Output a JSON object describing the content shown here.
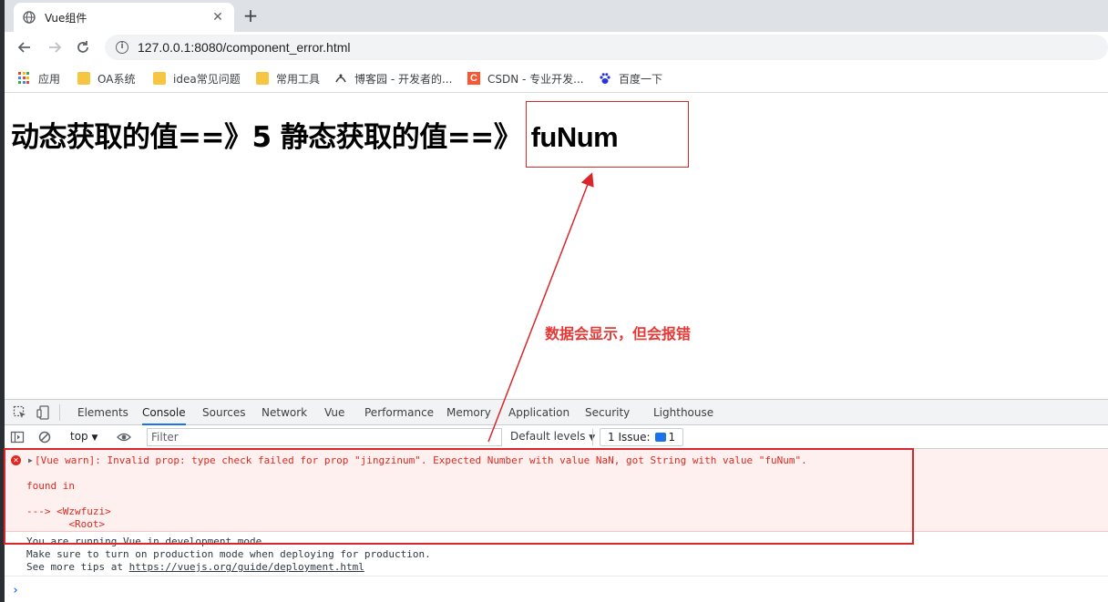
{
  "browser": {
    "tab_title": "Vue组件",
    "new_tab": "+",
    "close": "✕",
    "url": "127.0.0.1:8080/component_error.html",
    "bookmarks": [
      "应用",
      "OA系统",
      "idea常见问题",
      "常用工具",
      "博客园 - 开发者的...",
      "CSDN - 专业开发...",
      "百度一下"
    ]
  },
  "page": {
    "heading_prefix": "动态获取的值==》5 静态获取的值==》",
    "heading_value": "fuNum",
    "annotation": "数据会显示，但会报错"
  },
  "devtools": {
    "tabs": [
      "Elements",
      "Console",
      "Sources",
      "Network",
      "Vue",
      "Performance",
      "Memory",
      "Application",
      "Security",
      "Lighthouse"
    ],
    "active_tab": "Console",
    "context": "top",
    "filter_placeholder": "Filter",
    "levels": "Default levels",
    "issues_label": "1 Issue:",
    "issues_count": "1",
    "error_lines": [
      "[Vue warn]: Invalid prop: type check failed for prop \"jingzinum\". Expected Number with value NaN, got String with value \"fuNum\".",
      "found in",
      "---> <Wzwfuzi>",
      "       <Root>"
    ],
    "info_lines": [
      "You are running Vue in development mode.",
      "Make sure to turn on production mode when deploying for production.",
      "See more tips at "
    ],
    "info_link": "https://vuejs.org/guide/deployment.html",
    "prompt": "›"
  },
  "colors": {
    "annotation_red": "#e53935",
    "error_red": "#e0281f",
    "devtools_blue": "#1a73e8"
  }
}
